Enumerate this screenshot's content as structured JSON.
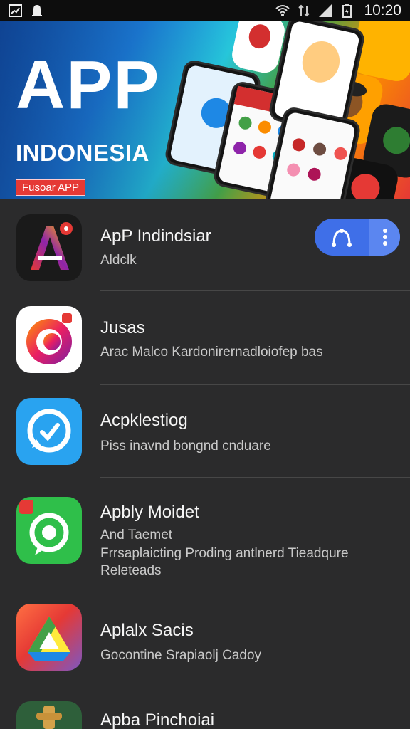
{
  "status_bar": {
    "time": "10:20",
    "left_icons": [
      "chart-notification-icon",
      "bell-notification-icon"
    ],
    "right_icons": [
      "wifi-icon",
      "data-icon",
      "signal-icon",
      "battery-icon"
    ]
  },
  "banner": {
    "title": "APP",
    "subtitle": "INDONESIA",
    "badge": "Fusoar APP"
  },
  "apps": [
    {
      "title": "ApP Indindsiar",
      "desc": [
        "Aldclk"
      ],
      "icon": "a-logo-icon"
    },
    {
      "title": "Jusas",
      "desc": [
        "Arac Malco Kardonirernadloiofep bas"
      ],
      "icon": "ring-logo-icon"
    },
    {
      "title": "Acpklestiog",
      "desc": [
        "Piss inavnd bongnd cnduare"
      ],
      "icon": "chat-check-icon"
    },
    {
      "title": "Apbly Moidet",
      "desc": [
        "And Taemet",
        "Frrsaplaicting Proding antlnerd Tieadqure",
        "Releteads"
      ],
      "icon": "green-chat-icon"
    },
    {
      "title": "Aplalx Sacis",
      "desc": [
        "Gocontine Srapiaolj Cadoy"
      ],
      "icon": "drive-triangle-icon"
    },
    {
      "title": "Apba Pinchoiai",
      "desc": [],
      "icon": "figure-icon"
    }
  ],
  "colors": {
    "background": "#2b2b2c",
    "status_bar": "#0d0d0d",
    "accent_blue": "#3f6fe8",
    "divider": "#474747"
  }
}
